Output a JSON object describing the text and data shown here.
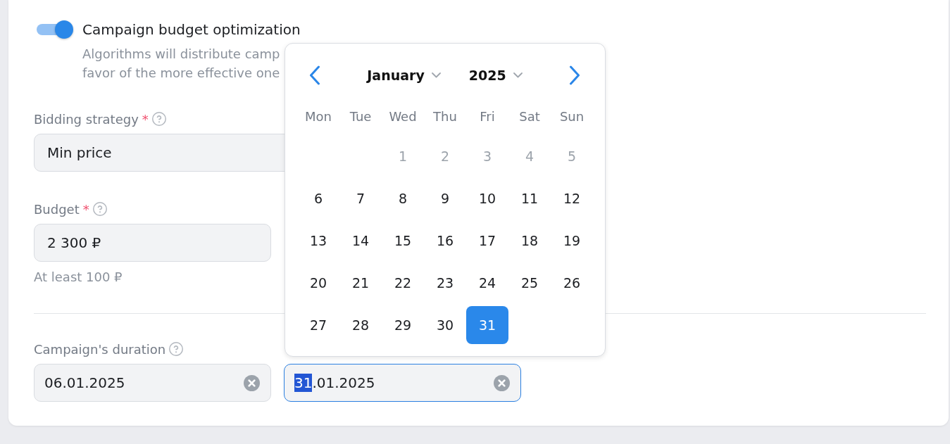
{
  "budget_optimization": {
    "on": true,
    "label": "Campaign budget optimization",
    "description_lines": [
      "Algorithms will distribute camp",
      "favor of the more effective one"
    ]
  },
  "bidding_strategy": {
    "label": "Bidding strategy",
    "required_mark": "*",
    "value": "Min price"
  },
  "budget": {
    "label": "Budget",
    "required_mark": "*",
    "value": "2 300 ₽",
    "hint": "At least 100 ₽"
  },
  "duration": {
    "label": "Campaign's duration",
    "fields": [
      {
        "focused": false,
        "value_parts": [
          {
            "text": "06.01.2025",
            "selected": false
          }
        ]
      },
      {
        "focused": true,
        "value_parts": [
          {
            "text": "31",
            "selected": true
          },
          {
            "text": ".01.2025",
            "selected": false
          }
        ]
      }
    ]
  },
  "calendar": {
    "month": "January",
    "year": "2025",
    "weekdays": [
      "Mon",
      "Tue",
      "Wed",
      "Thu",
      "Fri",
      "Sat",
      "Sun"
    ],
    "weeks": [
      [
        {
          "kind": "blank"
        },
        {
          "kind": "blank"
        },
        {
          "kind": "day",
          "day": "1",
          "disabled": true,
          "selected": false
        },
        {
          "kind": "day",
          "day": "2",
          "disabled": true,
          "selected": false
        },
        {
          "kind": "day",
          "day": "3",
          "disabled": true,
          "selected": false
        },
        {
          "kind": "day",
          "day": "4",
          "disabled": true,
          "selected": false
        },
        {
          "kind": "day",
          "day": "5",
          "disabled": true,
          "selected": false
        }
      ],
      [
        {
          "kind": "day",
          "day": "6",
          "disabled": false,
          "selected": false
        },
        {
          "kind": "day",
          "day": "7",
          "disabled": false,
          "selected": false
        },
        {
          "kind": "day",
          "day": "8",
          "disabled": false,
          "selected": false
        },
        {
          "kind": "day",
          "day": "9",
          "disabled": false,
          "selected": false
        },
        {
          "kind": "day",
          "day": "10",
          "disabled": false,
          "selected": false
        },
        {
          "kind": "day",
          "day": "11",
          "disabled": false,
          "selected": false
        },
        {
          "kind": "day",
          "day": "12",
          "disabled": false,
          "selected": false
        }
      ],
      [
        {
          "kind": "day",
          "day": "13",
          "disabled": false,
          "selected": false
        },
        {
          "kind": "day",
          "day": "14",
          "disabled": false,
          "selected": false
        },
        {
          "kind": "day",
          "day": "15",
          "disabled": false,
          "selected": false
        },
        {
          "kind": "day",
          "day": "16",
          "disabled": false,
          "selected": false
        },
        {
          "kind": "day",
          "day": "17",
          "disabled": false,
          "selected": false
        },
        {
          "kind": "day",
          "day": "18",
          "disabled": false,
          "selected": false
        },
        {
          "kind": "day",
          "day": "19",
          "disabled": false,
          "selected": false
        }
      ],
      [
        {
          "kind": "day",
          "day": "20",
          "disabled": false,
          "selected": false
        },
        {
          "kind": "day",
          "day": "21",
          "disabled": false,
          "selected": false
        },
        {
          "kind": "day",
          "day": "22",
          "disabled": false,
          "selected": false
        },
        {
          "kind": "day",
          "day": "23",
          "disabled": false,
          "selected": false
        },
        {
          "kind": "day",
          "day": "24",
          "disabled": false,
          "selected": false
        },
        {
          "kind": "day",
          "day": "25",
          "disabled": false,
          "selected": false
        },
        {
          "kind": "day",
          "day": "26",
          "disabled": false,
          "selected": false
        }
      ],
      [
        {
          "kind": "day",
          "day": "27",
          "disabled": false,
          "selected": false
        },
        {
          "kind": "day",
          "day": "28",
          "disabled": false,
          "selected": false
        },
        {
          "kind": "day",
          "day": "29",
          "disabled": false,
          "selected": false
        },
        {
          "kind": "day",
          "day": "30",
          "disabled": false,
          "selected": false
        },
        {
          "kind": "day",
          "day": "31",
          "disabled": false,
          "selected": true
        }
      ]
    ]
  }
}
